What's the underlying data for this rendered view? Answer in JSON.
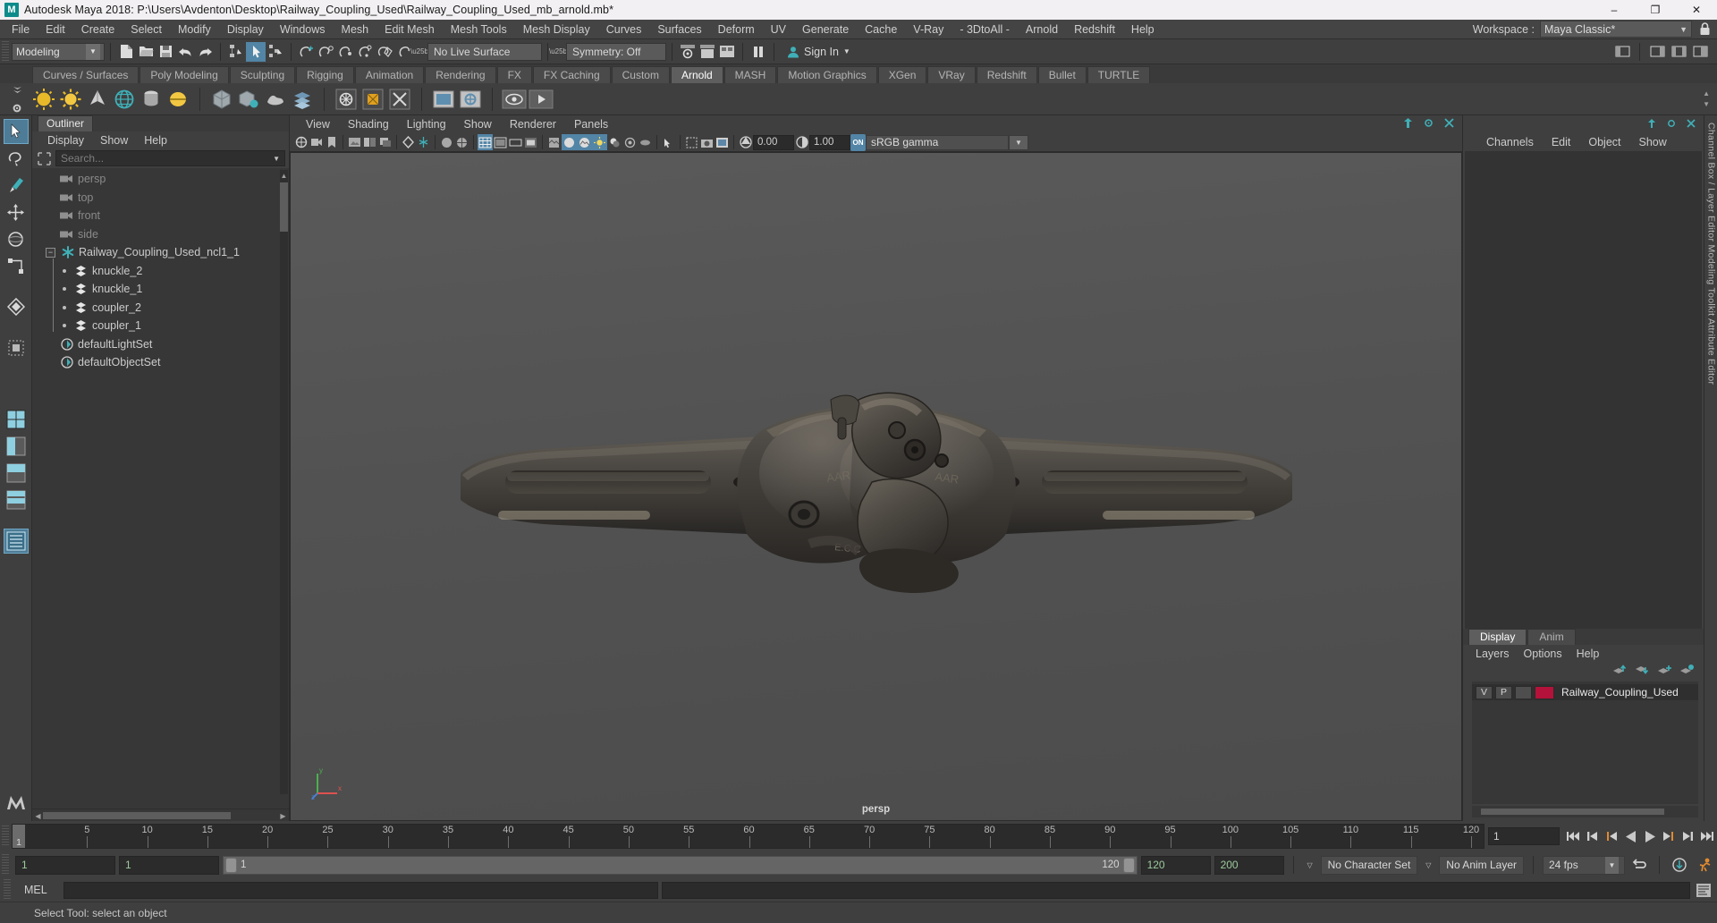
{
  "window": {
    "title": "Autodesk Maya 2018: P:\\Users\\Avdenton\\Desktop\\Railway_Coupling_Used\\Railway_Coupling_Used_mb_arnold.mb*",
    "logo_letter": "M",
    "minimize": "–",
    "maximize": "❐",
    "close": "✕"
  },
  "main_menu": {
    "items": [
      "File",
      "Edit",
      "Create",
      "Select",
      "Modify",
      "Display",
      "Windows",
      "Mesh",
      "Edit Mesh",
      "Mesh Tools",
      "Mesh Display",
      "Curves",
      "Surfaces",
      "Deform",
      "UV",
      "Generate",
      "Cache",
      "V-Ray",
      "- 3DtoAll -",
      "Arnold",
      "Redshift",
      "Help"
    ],
    "workspace_label": "Workspace :",
    "workspace_value": "Maya Classic*",
    "workspace_arrow": "▼",
    "lock_icon": "lock-icon"
  },
  "status_line": {
    "mode": "Modeling",
    "mode_arrow": "▼",
    "live_surface": "No Live Surface",
    "symmetry": "Symmetry: Off",
    "sign_in": "Sign In",
    "sign_in_arrow": "▼"
  },
  "shelf": {
    "tabs": [
      "Curves / Surfaces",
      "Poly Modeling",
      "Sculpting",
      "Rigging",
      "Animation",
      "Rendering",
      "FX",
      "FX Caching",
      "Custom",
      "Arnold",
      "MASH",
      "Motion Graphics",
      "XGen",
      "VRay",
      "Redshift",
      "Bullet",
      "TURTLE"
    ],
    "active_tab": "Arnold"
  },
  "outliner": {
    "tab": "Outliner",
    "menu": [
      "Display",
      "Show",
      "Help"
    ],
    "search_placeholder": "Search...",
    "search_arrow": "▼",
    "tree": [
      {
        "label": "persp",
        "icon": "camera-icon",
        "indent": 1,
        "dim": true
      },
      {
        "label": "top",
        "icon": "camera-icon",
        "indent": 1,
        "dim": true
      },
      {
        "label": "front",
        "icon": "camera-icon",
        "indent": 1,
        "dim": true
      },
      {
        "label": "side",
        "icon": "camera-icon",
        "indent": 1,
        "dim": true
      },
      {
        "label": "Railway_Coupling_Used_ncl1_1",
        "icon": "asterisk-icon",
        "indent": 1,
        "dim": false,
        "expanded": true
      },
      {
        "label": "knuckle_2",
        "icon": "mesh-icon",
        "indent": 2,
        "dim": false
      },
      {
        "label": "knuckle_1",
        "icon": "mesh-icon",
        "indent": 2,
        "dim": false
      },
      {
        "label": "coupler_2",
        "icon": "mesh-icon",
        "indent": 2,
        "dim": false
      },
      {
        "label": "coupler_1",
        "icon": "mesh-icon",
        "indent": 2,
        "dim": false
      },
      {
        "label": "defaultLightSet",
        "icon": "set-icon",
        "indent": 1,
        "dim": false
      },
      {
        "label": "defaultObjectSet",
        "icon": "set-icon",
        "indent": 1,
        "dim": false
      }
    ]
  },
  "viewport": {
    "menu": [
      "View",
      "Shading",
      "Lighting",
      "Show",
      "Renderer",
      "Panels"
    ],
    "exposure": "0.00",
    "gamma_value": "1.00",
    "color_management": "sRGB gamma",
    "cm_arrow": "▼",
    "cm_toggle": "ON",
    "camera_label": "persp",
    "axis_x": "x",
    "axis_y": "y",
    "axis_z": "z"
  },
  "right_dock": {
    "menu": [
      "Channels",
      "Edit",
      "Object",
      "Show"
    ],
    "rail_labels": "Channel Box / Layer Editor          Modeling Toolkit          Attribute Editor",
    "layer_editor": {
      "tabs": [
        "Display",
        "Anim"
      ],
      "active_tab": "Display",
      "menu": [
        "Layers",
        "Options",
        "Help"
      ],
      "columns": [
        "V",
        "P"
      ],
      "layers": [
        {
          "v": "V",
          "p": "P",
          "color": "#b4123a",
          "name": "Railway_Coupling_Used"
        }
      ]
    }
  },
  "time_slider": {
    "tick_labels": [
      "1",
      "5",
      "10",
      "15",
      "20",
      "25",
      "30",
      "35",
      "40",
      "45",
      "50",
      "55",
      "60",
      "65",
      "70",
      "75",
      "80",
      "85",
      "90",
      "95",
      "100",
      "105",
      "110",
      "115",
      "120"
    ],
    "current_frame": "1",
    "current_frame_field": "1",
    "playback_buttons": [
      "go-to-start-icon",
      "step-back-keyframe-icon",
      "step-back-frame-icon",
      "play-backwards-icon",
      "play-forwards-icon",
      "step-forward-frame-icon",
      "step-forward-keyframe-icon",
      "go-to-end-icon"
    ]
  },
  "range_slider": {
    "anim_start": "1",
    "playback_start": "1",
    "range_min_label": "1",
    "range_max_label": "120",
    "playback_end": "120",
    "anim_end": "200",
    "character_set": "No Character Set",
    "anim_layer": "No Anim Layer",
    "fps": "24 fps",
    "fps_arrow": "▼",
    "dropdown_arrow": "▽",
    "buttons": [
      "auto-key-icon",
      "animation-preferences-icon",
      "cycle-icon"
    ]
  },
  "command_line": {
    "language": "MEL",
    "input_value": "",
    "output_value": "",
    "script_editor_icon": "script-editor-icon"
  },
  "help_line": {
    "text": "Select Tool: select an object"
  },
  "colors": {
    "accent_blue": "#5285a6",
    "teal": "#3fb0b8",
    "layer_red": "#b4123a",
    "panel_bg": "#3f3f3f",
    "dark_bg": "#2b2b2b",
    "viewport_bg": "#555555",
    "orange": "#e08a30"
  }
}
